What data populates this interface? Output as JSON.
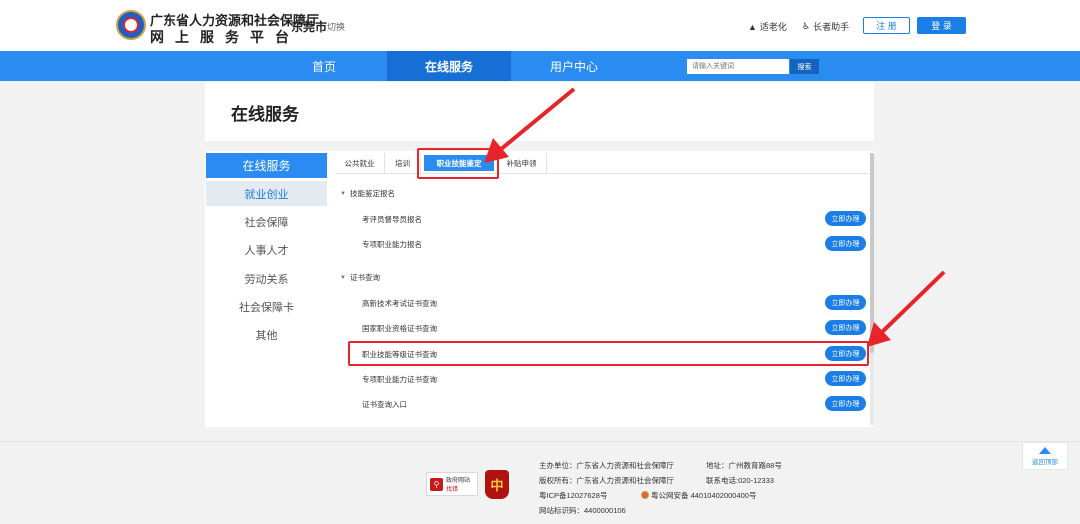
{
  "header": {
    "org_line1": "广东省人力资源和社会保障厅",
    "org_line2": "网上服务平台",
    "city": "东莞市",
    "switch_label": "切换",
    "elder_mode": "适老化",
    "elder_helper": "长者助手",
    "register": "注 册",
    "login": "登 录"
  },
  "nav": {
    "items": [
      {
        "label": "首页"
      },
      {
        "label": "在线服务"
      },
      {
        "label": "用户中心"
      }
    ],
    "search_placeholder": "请输入关键词",
    "search_button": "搜索"
  },
  "page": {
    "title": "在线服务"
  },
  "sidebar": {
    "header": "在线服务",
    "items": [
      {
        "label": "就业创业",
        "active": true
      },
      {
        "label": "社会保障"
      },
      {
        "label": "人事人才"
      },
      {
        "label": "劳动关系"
      },
      {
        "label": "社会保障卡"
      },
      {
        "label": "其他"
      }
    ]
  },
  "tabs": [
    {
      "label": "公共就业"
    },
    {
      "label": "培训"
    },
    {
      "label": "职业技能鉴定",
      "active": true
    },
    {
      "label": "补贴申领"
    }
  ],
  "groups": [
    {
      "title": "技能鉴定报名",
      "rows": [
        {
          "label": "考评员督导员报名",
          "action": "立即办理"
        },
        {
          "label": "专项职业能力报名",
          "action": "立即办理"
        }
      ]
    },
    {
      "title": "证书查询",
      "rows": [
        {
          "label": "高新技术考试证书查询",
          "action": "立即办理"
        },
        {
          "label": "国家职业资格证书查询",
          "action": "立即办理"
        },
        {
          "label": "职业技能等级证书查询",
          "action": "立即办理"
        },
        {
          "label": "专项职业能力证书查询",
          "action": "立即办理"
        },
        {
          "label": "证书查询入口",
          "action": "立即办理"
        }
      ]
    }
  ],
  "back_to_top": "返回顶部",
  "footer": {
    "gov_site_line1": "政府网站",
    "gov_site_line2": "找错",
    "emblem_glyph": "中",
    "host": "主办单位：广东省人力资源和社会保障厅",
    "address": "地址：广州教育路88号",
    "copyright": "版权所有：广东省人力资源和社会保障厅",
    "phone": "联系电话:020-12333",
    "icp": "粤ICP备12027628号",
    "police": "粤公网安备 44010402000400号",
    "site_id": "网站标识码：4400000106"
  },
  "colors": {
    "primary": "#2a8cf0",
    "nav_active": "#166fd4",
    "highlight": "#e8242b"
  }
}
